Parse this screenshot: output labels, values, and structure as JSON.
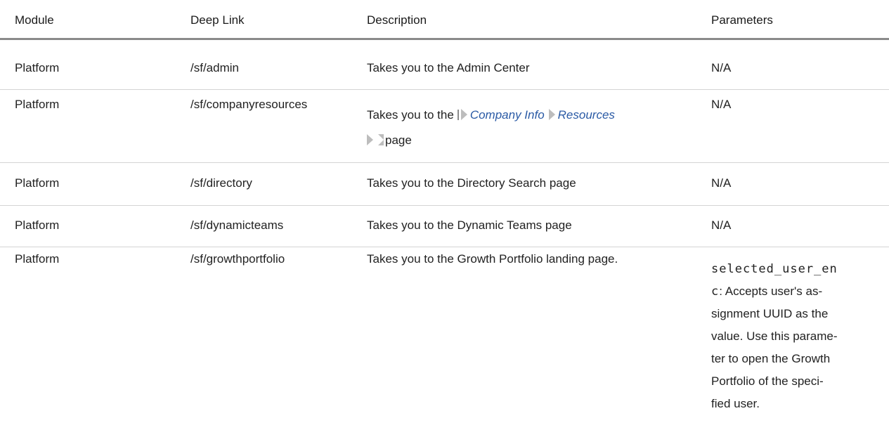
{
  "headers": {
    "module": "Module",
    "deep_link": "Deep Link",
    "description": "Description",
    "parameters": "Parameters"
  },
  "rows": [
    {
      "module": "Platform",
      "deep_link": "/sf/admin",
      "description": "Takes you to the Admin Center",
      "parameters": "N/A"
    },
    {
      "module": "Platform",
      "deep_link": "/sf/companyresources",
      "description_prefix": "Takes you to the",
      "breadcrumb_1": "Company Info",
      "breadcrumb_2": "Resources",
      "description_suffix": "page",
      "parameters": "N/A"
    },
    {
      "module": "Platform",
      "deep_link": "/sf/directory",
      "description": "Takes you to the Directory Search page",
      "parameters": "N/A"
    },
    {
      "module": "Platform",
      "deep_link": "/sf/dynamicteams",
      "description": "Takes you to the Dynamic Teams page",
      "parameters": "N/A"
    },
    {
      "module": "Platform",
      "deep_link": "/sf/growthportfolio",
      "description": "Takes you to the Growth Portfolio landing page.",
      "parameters_code_line1": "selected_user_en",
      "parameters_code_line2": "c",
      "parameters_lines": [
        ": Accepts user's as-",
        "signment UUID as the",
        "value. Use this parame-",
        "ter to open the Growth",
        "Portfolio of the speci-",
        "fied user."
      ]
    }
  ]
}
